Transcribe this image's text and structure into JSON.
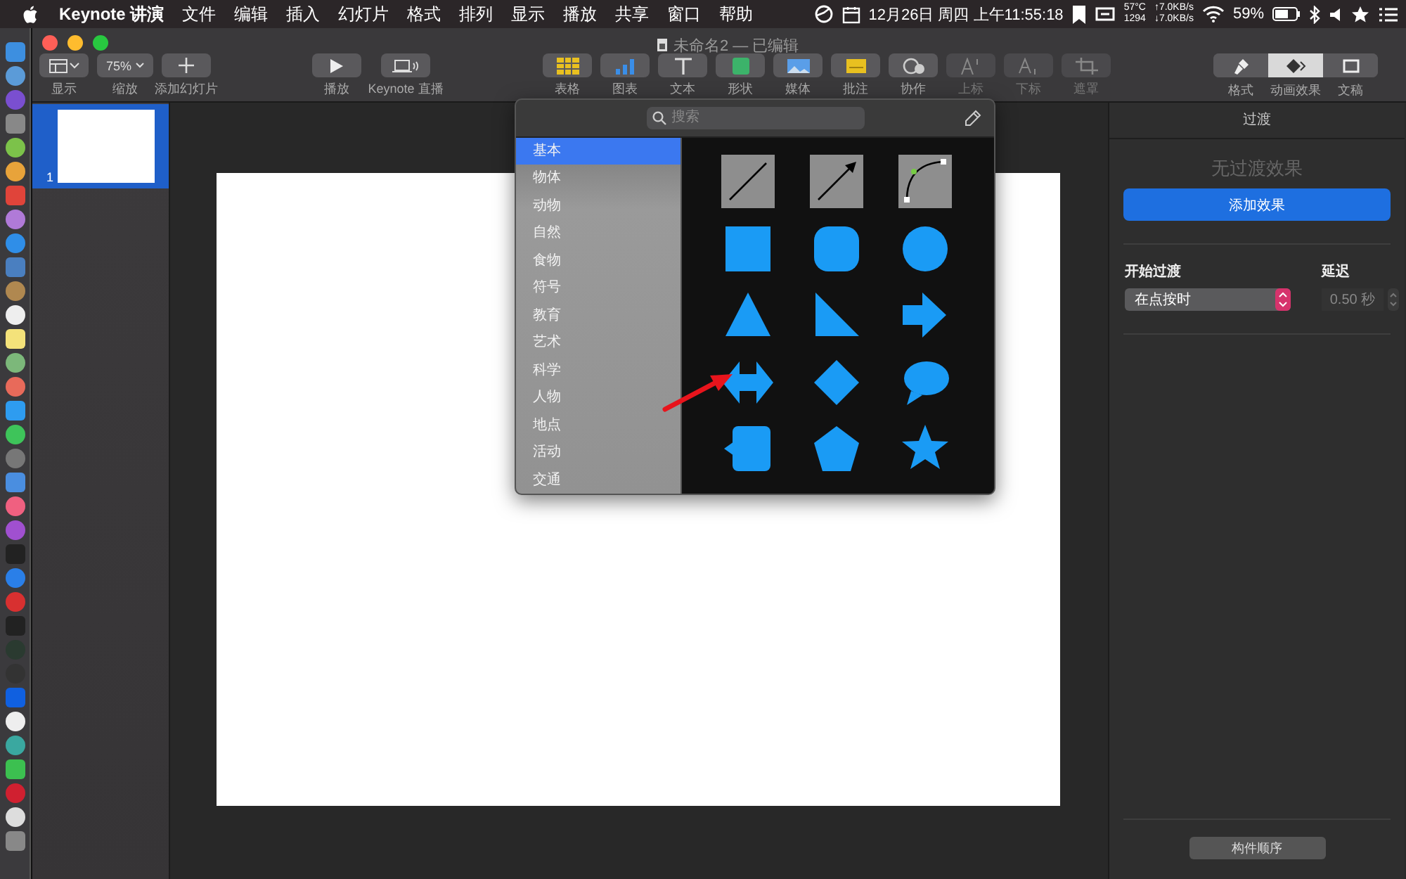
{
  "menu_bar": {
    "app_name": "Keynote 讲演",
    "menus": [
      "文件",
      "编辑",
      "插入",
      "幻灯片",
      "格式",
      "排列",
      "显示",
      "播放",
      "共享",
      "窗口",
      "帮助"
    ],
    "clock": "12月26日 周四 上午11:55:18",
    "temperature": "57°C",
    "fan": "1294",
    "upload": "↑7.0KB/s",
    "download": "↓7.0KB/s",
    "battery": "59%"
  },
  "window": {
    "title": "未命名2 — 已编辑"
  },
  "toolbar": {
    "left": [
      {
        "label": "显示",
        "kind": "view"
      },
      {
        "label": "缩放",
        "kind": "zoom",
        "value": "75%"
      },
      {
        "label": "添加幻灯片",
        "kind": "add"
      }
    ],
    "center": [
      {
        "label": "播放",
        "kind": "play"
      },
      {
        "label": "Keynote 直播",
        "kind": "live"
      }
    ],
    "insert": [
      {
        "label": "表格",
        "kind": "table",
        "disabled": false
      },
      {
        "label": "图表",
        "kind": "chart",
        "disabled": false
      },
      {
        "label": "文本",
        "kind": "text",
        "disabled": false
      },
      {
        "label": "形状",
        "kind": "shape",
        "disabled": false
      },
      {
        "label": "媒体",
        "kind": "media",
        "disabled": false
      },
      {
        "label": "批注",
        "kind": "comment",
        "disabled": false
      },
      {
        "label": "协作",
        "kind": "collab",
        "disabled": false
      },
      {
        "label": "上标",
        "kind": "superscript",
        "disabled": true
      },
      {
        "label": "下标",
        "kind": "subscript",
        "disabled": true
      },
      {
        "label": "遮罩",
        "kind": "mask",
        "disabled": true
      }
    ],
    "inspector_tabs": [
      {
        "label": "格式",
        "kind": "format",
        "selected": false
      },
      {
        "label": "动画效果",
        "kind": "animate",
        "selected": true
      },
      {
        "label": "文稿",
        "kind": "document",
        "selected": false
      }
    ]
  },
  "slides": [
    {
      "number": "1",
      "selected": true
    }
  ],
  "shape_popover": {
    "search_placeholder": "搜索",
    "categories": [
      {
        "label": "基本",
        "selected": true
      },
      {
        "label": "物体",
        "selected": false
      },
      {
        "label": "动物",
        "selected": false
      },
      {
        "label": "自然",
        "selected": false
      },
      {
        "label": "食物",
        "selected": false
      },
      {
        "label": "符号",
        "selected": false
      },
      {
        "label": "教育",
        "selected": false
      },
      {
        "label": "艺术",
        "selected": false
      },
      {
        "label": "科学",
        "selected": false
      },
      {
        "label": "人物",
        "selected": false
      },
      {
        "label": "地点",
        "selected": false
      },
      {
        "label": "活动",
        "selected": false
      },
      {
        "label": "交通",
        "selected": false
      }
    ],
    "shapes": [
      {
        "kind": "line"
      },
      {
        "kind": "arrow-line"
      },
      {
        "kind": "curve"
      },
      {
        "kind": "square"
      },
      {
        "kind": "rounded-square"
      },
      {
        "kind": "circle"
      },
      {
        "kind": "triangle"
      },
      {
        "kind": "right-triangle"
      },
      {
        "kind": "arrow"
      },
      {
        "kind": "double-arrow"
      },
      {
        "kind": "diamond"
      },
      {
        "kind": "speech-bubble"
      },
      {
        "kind": "callout"
      },
      {
        "kind": "pentagon"
      },
      {
        "kind": "star"
      }
    ]
  },
  "inspector": {
    "title": "过渡",
    "empty_text": "无过渡效果",
    "add_button": "添加效果",
    "start_label": "开始过渡",
    "start_value": "在点按时",
    "delay_label": "延迟",
    "delay_value": "0.50 秒",
    "build_order_button": "构件顺序"
  }
}
